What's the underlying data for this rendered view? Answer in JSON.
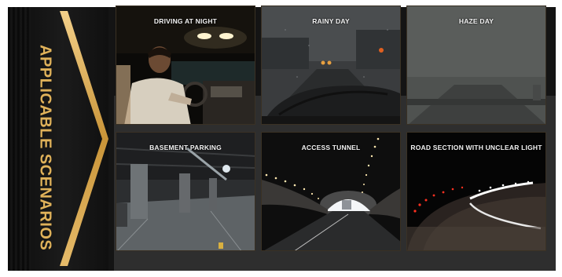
{
  "banner": {
    "title": "APPLICABLE SCENARIOS",
    "accent_color": "#d9a94e"
  },
  "tiles": [
    {
      "label": "DRIVING AT NIGHT",
      "scene": "night-driving-car-interior"
    },
    {
      "label": "RAINY DAY",
      "scene": "rainy-windshield-road"
    },
    {
      "label": "HAZE DAY",
      "scene": "hazy-road"
    },
    {
      "label": "BASEMENT PARKING",
      "scene": "underground-parking-garage"
    },
    {
      "label": "ACCESS TUNNEL",
      "scene": "lit-road-tunnel"
    },
    {
      "label": "ROAD SECTION WITH UNCLEAR LIGHT",
      "scene": "dark-curved-road-with-reflectors"
    }
  ]
}
